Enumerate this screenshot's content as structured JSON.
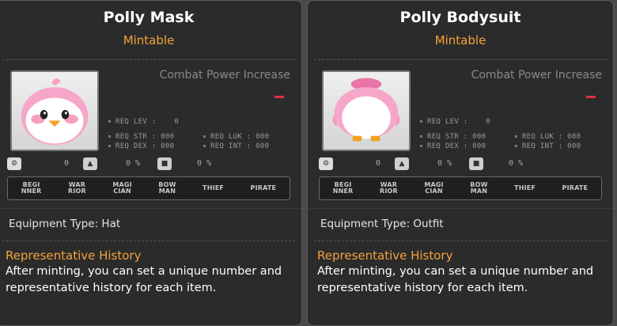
{
  "cards": [
    {
      "title": "Polly Mask",
      "mintable": "Mintable",
      "combat_power_label": "Combat Power Increase",
      "req_lev": "REQ LEV :    0",
      "req_str": "REQ STR : 000",
      "req_dex": "REQ DEX : 000",
      "req_luk": "REQ LUK : 000",
      "req_int": "REQ INT : 000",
      "stat1": "0",
      "stat2": "0 %",
      "stat3": "0 %",
      "classes": [
        "BEGI NNER",
        "WAR RIOR",
        "MAGI CIAN",
        "BOW MAN",
        "THIEF",
        "PIRATE"
      ],
      "equipment_type": "Equipment Type: Hat",
      "history_title": "Representative History",
      "history_text": "After minting, you can set a unique number and representative history for each item.",
      "item_icon": "pink-bird-mask-icon",
      "item_color": "#f8a8c8"
    },
    {
      "title": "Polly Bodysuit",
      "mintable": "Mintable",
      "combat_power_label": "Combat Power Increase",
      "req_lev": "REQ LEV :    0",
      "req_str": "REQ STR : 000",
      "req_dex": "REQ DEX : 000",
      "req_luk": "REQ LUK : 000",
      "req_int": "REQ INT : 000",
      "stat1": "0",
      "stat2": "0 %",
      "stat3": "0 %",
      "classes": [
        "BEGI NNER",
        "WAR RIOR",
        "MAGI CIAN",
        "BOW MAN",
        "THIEF",
        "PIRATE"
      ],
      "equipment_type": "Equipment Type: Outfit",
      "history_title": "Representative History",
      "history_text": "After minting, you can set a unique number and representative history for each item.",
      "item_icon": "pink-bird-bodysuit-icon",
      "item_color": "#f8a8c8"
    }
  ],
  "colors": {
    "accent_orange": "#f4a23a",
    "power_red": "#e0304a",
    "panel_bg": "#2b2b2b"
  }
}
